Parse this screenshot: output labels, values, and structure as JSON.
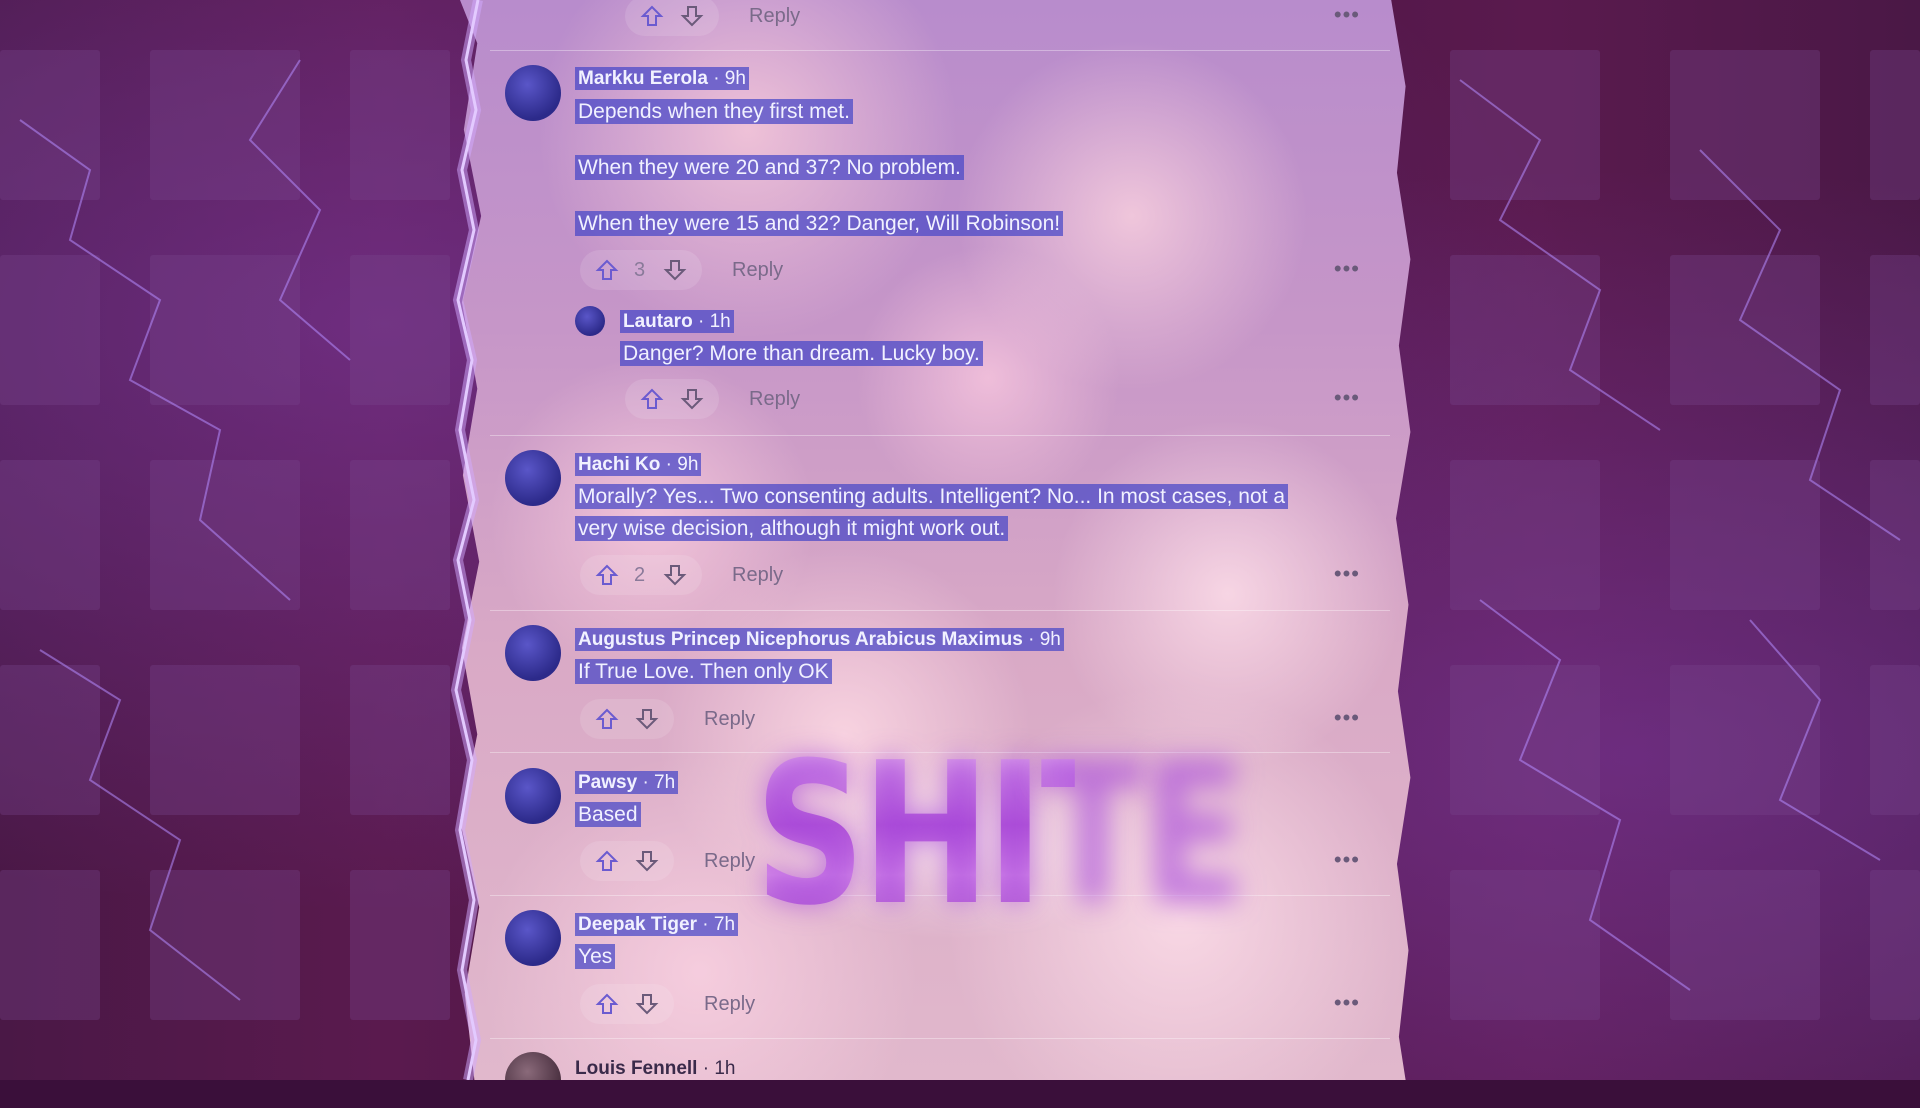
{
  "overlay_text": "SHITE",
  "comments": [
    {
      "id": "top-partial",
      "reply_label": "Reply",
      "score": "",
      "more": "•••"
    },
    {
      "id": "markku",
      "user": "Markku Eerola",
      "time": "· 9h",
      "lines": [
        "Depends when they first met.",
        "When they were 20 and 37? No problem.",
        "When they were 15 and 32? Danger, Will Robinson!"
      ],
      "score": "3",
      "reply_label": "Reply",
      "more": "•••"
    },
    {
      "id": "lautaro",
      "user": "Lautaro",
      "time": "· 1h",
      "lines": [
        "Danger? More than dream. Lucky boy."
      ],
      "score": "",
      "reply_label": "Reply",
      "more": "•••"
    },
    {
      "id": "hachi",
      "user": "Hachi Ko",
      "time": "· 9h",
      "lines": [
        "Morally? Yes... Two consenting adults. Intelligent? No... In most cases, not a",
        "very wise decision, although it might work out."
      ],
      "score": "2",
      "reply_label": "Reply",
      "more": "•••"
    },
    {
      "id": "augustus",
      "user": "Augustus Princep Nicephorus Arabicus Maximus",
      "time": "· 9h",
      "lines": [
        "If True Love. Then only OK"
      ],
      "score": "",
      "reply_label": "Reply",
      "more": "•••"
    },
    {
      "id": "pawsy",
      "user": "Pawsy",
      "time": "· 7h",
      "lines": [
        "Based"
      ],
      "score": "",
      "reply_label": "Reply",
      "more": "•••"
    },
    {
      "id": "deepak",
      "user": "Deepak Tiger",
      "time": "· 7h",
      "lines": [
        "Yes"
      ],
      "score": "",
      "reply_label": "Reply",
      "more": "•••"
    },
    {
      "id": "louis",
      "user": "Louis Fennell",
      "time": "· 1h"
    }
  ],
  "colors": {
    "highlight": "#4646c8",
    "panel": "#c696c8",
    "background": "#4b1444",
    "overlay": "#c77ee0"
  }
}
